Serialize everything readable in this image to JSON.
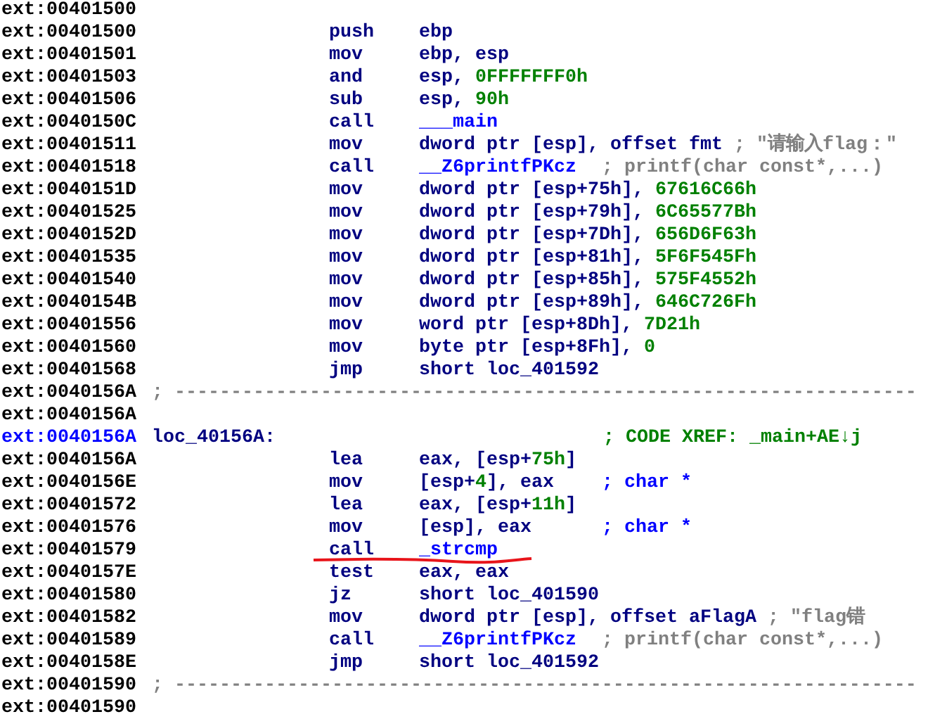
{
  "lines": [
    {
      "kind": "blank",
      "address": "ext:00401500"
    },
    {
      "kind": "code",
      "address": "ext:00401500",
      "mnemonic": "push",
      "operands": [
        {
          "text": "ebp",
          "kind": "reg"
        }
      ]
    },
    {
      "kind": "code",
      "address": "ext:00401501",
      "mnemonic": "mov",
      "operands": [
        {
          "text": "ebp, esp",
          "kind": "reg"
        }
      ]
    },
    {
      "kind": "code",
      "address": "ext:00401503",
      "mnemonic": "and",
      "operands": [
        {
          "text": "esp, ",
          "kind": "reg"
        },
        {
          "text": "0FFFFFFF0h",
          "kind": "num"
        }
      ]
    },
    {
      "kind": "code",
      "address": "ext:00401506",
      "mnemonic": "sub",
      "operands": [
        {
          "text": "esp, ",
          "kind": "reg"
        },
        {
          "text": "90h",
          "kind": "num"
        }
      ]
    },
    {
      "kind": "code",
      "address": "ext:0040150C",
      "mnemonic": "call",
      "operands": [
        {
          "text": "___main",
          "kind": "sym"
        }
      ]
    },
    {
      "kind": "code",
      "address": "ext:00401511",
      "mnemonic": "mov",
      "operands": [
        {
          "text": "dword ptr [esp], offset fmt",
          "kind": "reg"
        }
      ],
      "comment": {
        "text": "; \"请输入flag：\"",
        "kind": "info"
      }
    },
    {
      "kind": "code",
      "address": "ext:00401518",
      "mnemonic": "call",
      "operands": [
        {
          "text": "__Z6printfPKcz",
          "kind": "sym"
        }
      ],
      "comment": {
        "text": "; printf(char const*,...)",
        "kind": "info"
      }
    },
    {
      "kind": "code",
      "address": "ext:0040151D",
      "mnemonic": "mov",
      "operands": [
        {
          "text": "dword ptr [esp+75h], ",
          "kind": "reg"
        },
        {
          "text": "67616C66h",
          "kind": "num"
        }
      ]
    },
    {
      "kind": "code",
      "address": "ext:00401525",
      "mnemonic": "mov",
      "operands": [
        {
          "text": "dword ptr [esp+79h], ",
          "kind": "reg"
        },
        {
          "text": "6C65577Bh",
          "kind": "num"
        }
      ]
    },
    {
      "kind": "code",
      "address": "ext:0040152D",
      "mnemonic": "mov",
      "operands": [
        {
          "text": "dword ptr [esp+7Dh], ",
          "kind": "reg"
        },
        {
          "text": "656D6F63h",
          "kind": "num"
        }
      ]
    },
    {
      "kind": "code",
      "address": "ext:00401535",
      "mnemonic": "mov",
      "operands": [
        {
          "text": "dword ptr [esp+81h], ",
          "kind": "reg"
        },
        {
          "text": "5F6F545Fh",
          "kind": "num"
        }
      ]
    },
    {
      "kind": "code",
      "address": "ext:00401540",
      "mnemonic": "mov",
      "operands": [
        {
          "text": "dword ptr [esp+85h], ",
          "kind": "reg"
        },
        {
          "text": "575F4552h",
          "kind": "num"
        }
      ]
    },
    {
      "kind": "code",
      "address": "ext:0040154B",
      "mnemonic": "mov",
      "operands": [
        {
          "text": "dword ptr [esp+89h], ",
          "kind": "reg"
        },
        {
          "text": "646C726Fh",
          "kind": "num"
        }
      ]
    },
    {
      "kind": "code",
      "address": "ext:00401556",
      "mnemonic": "mov",
      "operands": [
        {
          "text": "word ptr [esp+8Dh], ",
          "kind": "reg"
        },
        {
          "text": "7D21h",
          "kind": "num"
        }
      ]
    },
    {
      "kind": "code",
      "address": "ext:00401560",
      "mnemonic": "mov",
      "operands": [
        {
          "text": "byte ptr [esp+8Fh], ",
          "kind": "reg"
        },
        {
          "text": "0",
          "kind": "num"
        }
      ]
    },
    {
      "kind": "code",
      "address": "ext:00401568",
      "mnemonic": "jmp",
      "operands": [
        {
          "text": "short loc_401592",
          "kind": "reg"
        }
      ]
    },
    {
      "kind": "separator",
      "address": "ext:0040156A",
      "text": "; ------------------------------------------------------------------"
    },
    {
      "kind": "blank",
      "address": "ext:0040156A"
    },
    {
      "kind": "label",
      "address": "ext:0040156A",
      "label": "loc_40156A:",
      "comment": {
        "text": "; CODE XREF: _main+AE↓j",
        "kind": "xref"
      }
    },
    {
      "kind": "code",
      "address": "ext:0040156A",
      "mnemonic": "lea",
      "operands": [
        {
          "text": "eax, [esp+",
          "kind": "reg"
        },
        {
          "text": "75h",
          "kind": "num"
        },
        {
          "text": "]",
          "kind": "reg"
        }
      ]
    },
    {
      "kind": "code",
      "address": "ext:0040156E",
      "mnemonic": "mov",
      "operands": [
        {
          "text": "[esp+",
          "kind": "reg"
        },
        {
          "text": "4",
          "kind": "num"
        },
        {
          "text": "], eax",
          "kind": "reg"
        }
      ],
      "comment": {
        "text": "; char *",
        "kind": "type"
      }
    },
    {
      "kind": "code",
      "address": "ext:00401572",
      "mnemonic": "lea",
      "operands": [
        {
          "text": "eax, [esp+",
          "kind": "reg"
        },
        {
          "text": "11h",
          "kind": "num"
        },
        {
          "text": "]",
          "kind": "reg"
        }
      ]
    },
    {
      "kind": "code",
      "address": "ext:00401576",
      "mnemonic": "mov",
      "operands": [
        {
          "text": "[esp], eax",
          "kind": "reg"
        }
      ],
      "comment": {
        "text": "; char *",
        "kind": "type"
      }
    },
    {
      "kind": "code",
      "address": "ext:00401579",
      "mnemonic": "call",
      "operands": [
        {
          "text": "_strcmp",
          "kind": "sym"
        }
      ],
      "underlined": true
    },
    {
      "kind": "code",
      "address": "ext:0040157E",
      "mnemonic": "test",
      "operands": [
        {
          "text": "eax, eax",
          "kind": "reg"
        }
      ]
    },
    {
      "kind": "code",
      "address": "ext:00401580",
      "mnemonic": "jz",
      "operands": [
        {
          "text": "short loc_401590",
          "kind": "reg"
        }
      ]
    },
    {
      "kind": "code",
      "address": "ext:00401582",
      "mnemonic": "mov",
      "operands": [
        {
          "text": "dword ptr [esp], offset aFlagA",
          "kind": "reg"
        }
      ],
      "comment": {
        "text": "; \"flag错",
        "kind": "info"
      }
    },
    {
      "kind": "code",
      "address": "ext:00401589",
      "mnemonic": "call",
      "operands": [
        {
          "text": "__Z6printfPKcz",
          "kind": "sym"
        }
      ],
      "comment": {
        "text": "; printf(char const*,...)",
        "kind": "info"
      }
    },
    {
      "kind": "code",
      "address": "ext:0040158E",
      "mnemonic": "jmp",
      "operands": [
        {
          "text": "short loc_401592",
          "kind": "reg"
        }
      ]
    },
    {
      "kind": "separator",
      "address": "ext:00401590",
      "text": "; ------------------------------------------------------------------"
    },
    {
      "kind": "blank",
      "address": "ext:00401590"
    }
  ]
}
